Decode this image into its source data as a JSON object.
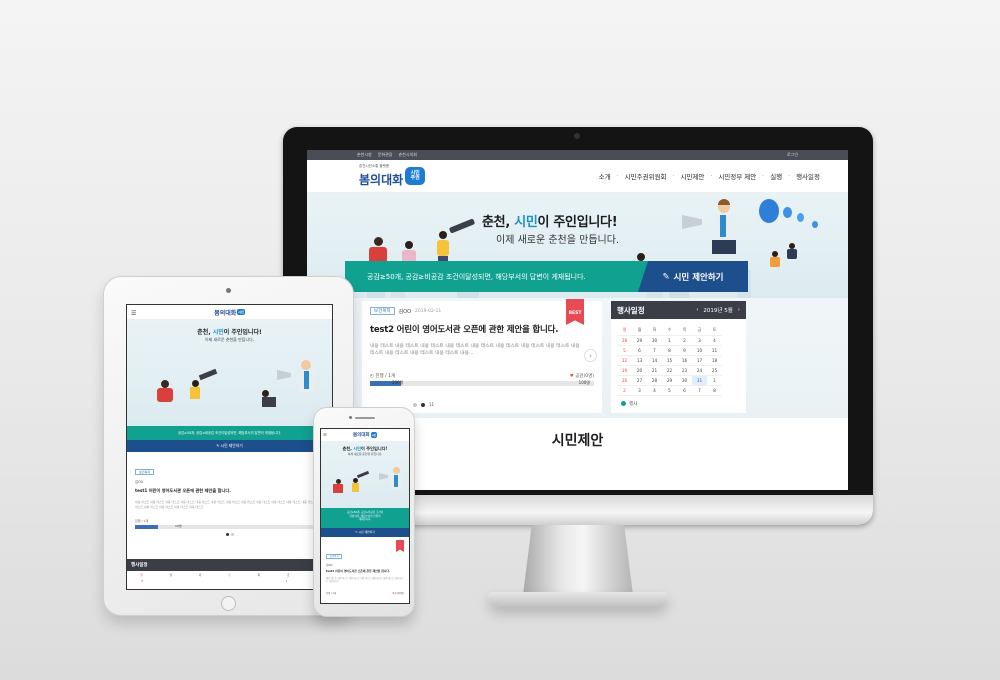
{
  "desktop": {
    "topbar": {
      "links": [
        "춘천시청",
        "문화관광",
        "춘천시의회"
      ],
      "right": "로그인"
    },
    "logo": {
      "small": "춘천시민소통 플랫폼",
      "big": "봄의대화",
      "badge_line1": "시민",
      "badge_line2": "주권"
    },
    "nav": [
      "소개",
      "시민주권위원회",
      "시민제안",
      "시민정부 제안",
      "실행",
      "행사일정"
    ],
    "hero": {
      "title_prefix": "춘천, ",
      "title_highlight": "시민",
      "title_suffix": "이 주인입니다!",
      "subtitle": "이제 새로운 춘천을 만듭니다."
    },
    "banner": {
      "text": "공감≥50개, 공감≥비공감 조건이달성되면, 해당부서의 답변이 게재됩니다.",
      "button": "시민 제안하기"
    },
    "card": {
      "tag": "보건복지",
      "author": "김OO",
      "date": "2019-02-11",
      "best": "BEST",
      "title": "test2 어린이 영어도서관 오픈에 관한 제안을 합니다.",
      "body": "내용 테스트 내용 테스트 내용 테스트 내용 테스트 내용 테스트 내용 테스트 내용 테스트 내용 테스트 내용 테스트 내용 테스트 내용 테스트 내용 테스트 내용...",
      "left_stat": "진행 / 1개",
      "right_stat": "공감(0명)",
      "progress": 0.14,
      "bar_left": "200명",
      "bar_right": "100명",
      "page_label": "11"
    },
    "calendar": {
      "title": "행사일정",
      "month": "2019년 5월",
      "weekdays": [
        "일",
        "월",
        "화",
        "수",
        "목",
        "금",
        "토"
      ],
      "rows": [
        [
          "28",
          "29",
          "30",
          "1",
          "2",
          "3",
          "4"
        ],
        [
          "5",
          "6",
          "7",
          "8",
          "9",
          "10",
          "11"
        ],
        [
          "12",
          "13",
          "14",
          "15",
          "16",
          "17",
          "18"
        ],
        [
          "19",
          "20",
          "21",
          "22",
          "23",
          "24",
          "25"
        ],
        [
          "26",
          "27",
          "28",
          "29",
          "30",
          "31",
          "1"
        ],
        [
          "2",
          "3",
          "4",
          "5",
          "6",
          "7",
          "8"
        ]
      ],
      "legend": "행사"
    },
    "section_title": "시민제안"
  },
  "tablet": {
    "hero_title_prefix": "춘천, ",
    "hero_title_highlight": "시민",
    "hero_title_suffix": "이 주인입니다!",
    "hero_subtitle": "이제 새로운 춘천을 만듭니다.",
    "banner_text": "공감≥50개, 공감≥비공감 조건이달성되면, 해당부서의 답변이 게재됩니다.",
    "button": "시민 제안하기",
    "tag": "보건복지",
    "author": "김OO",
    "title": "test1 어린이 영어도서관 오픈에 관한 제안을 합니다.",
    "body": "내용 테스트 내용 테스트 내용 테스트 내용 테스트 내용 테스트 내용 테스트 내용 테스트 내용 테스트 내용 테스트 내용 테스트 내용 테스트 내용 테스트 내용 테스트 내용 테스트 내용 테스트 내용 테스트 내용 테스트",
    "stat": "진행 / 1개",
    "bar_label": "10명",
    "cal_title": "행사일정",
    "cal_month": "2019",
    "weekdays": [
      "일",
      "월",
      "화",
      "수",
      "목",
      "금",
      "토"
    ],
    "first_row": [
      "8",
      "",
      "",
      "",
      "",
      "1",
      "1"
    ]
  },
  "phone": {
    "hero_title_prefix": "춘천, ",
    "hero_title_highlight": "시민",
    "hero_title_suffix": "이 주인입니다!",
    "hero_subtitle": "이제 새로운 춘천을 만듭니다.",
    "banner_line1": "공감≥50개, 공감≥비공감 조건이",
    "banner_line2": "달성되면, 해당부서의 답변이",
    "banner_line3": "게재됩니다.",
    "button": "시민 제안하기",
    "tag": "보건복지",
    "author": "김OO",
    "title": "test1 어린이 영어도서관 오픈에 관한 제안을 합니다.",
    "body": "내용 테스트 내용 테스트 내용 테스트 내용 테스트 내용 테스트 내용 테스트 내용 테스트 내용 테스트",
    "left_stat": "진행 / 1개",
    "right_stat": "공감(0명)"
  },
  "colors": {
    "teal": "#10a191",
    "navy": "#1d4f8c",
    "dark": "#3b3e46",
    "accent": "#1d8fc7",
    "red": "#e84a53"
  }
}
